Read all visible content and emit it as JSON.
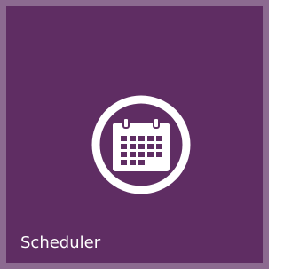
{
  "tile": {
    "label": "Scheduler",
    "icon": "calendar-icon",
    "background_color": "#5f2d63",
    "border_color": "#8c6a90"
  }
}
